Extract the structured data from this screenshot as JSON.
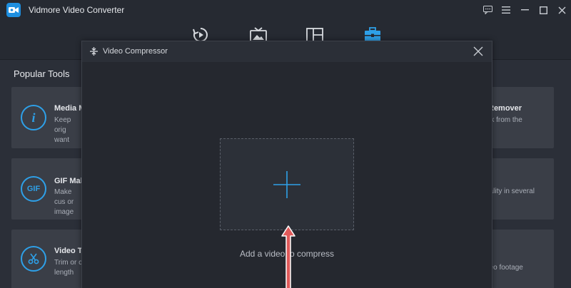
{
  "app": {
    "title": "Vidmore Video Converter",
    "logo_icon": "video-camera-icon",
    "accent_color": "#1e8fe0"
  },
  "window_controls": [
    {
      "name": "feedback-icon"
    },
    {
      "name": "menu-icon"
    },
    {
      "name": "minimize-icon"
    },
    {
      "name": "maximize-icon"
    },
    {
      "name": "close-icon"
    }
  ],
  "nav_tabs": [
    {
      "name": "converter-tab",
      "icon": "refresh-play-icon",
      "active": false
    },
    {
      "name": "mv-tab",
      "icon": "tv-image-icon",
      "active": false
    },
    {
      "name": "collage-tab",
      "icon": "layout-grid-icon",
      "active": false
    },
    {
      "name": "toolbox-tab",
      "icon": "toolbox-icon",
      "active": true
    }
  ],
  "page": {
    "section_title": "Popular Tools"
  },
  "tools_left": [
    {
      "name": "Media M",
      "desc": "Keep orig want",
      "icon_text": "i",
      "icon": "info-icon"
    },
    {
      "name": "GIF Make",
      "desc": "Make cus or image",
      "icon_text": "GIF",
      "icon": "gif-icon"
    },
    {
      "name": "Video Tr",
      "desc": "Trim or c length",
      "icon_text": "",
      "icon": "scissors-icon"
    }
  ],
  "tools_right": [
    {
      "name": "Remover",
      "desc": "rk from the"
    },
    {
      "name": "",
      "desc": "uality in several"
    },
    {
      "name": "",
      "desc": "deo footage"
    }
  ],
  "modal": {
    "title": "Video Compressor",
    "title_icon": "compress-icon",
    "close_icon": "close-icon",
    "drop_label": "Add a video to compress",
    "add_icon": "plus-icon",
    "pointer_color": "#e05a5a"
  }
}
